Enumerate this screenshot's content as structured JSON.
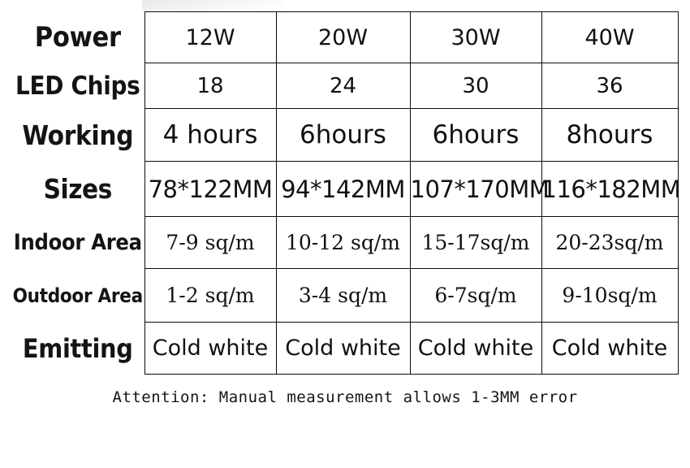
{
  "table": {
    "columns": [
      "12W",
      "20W",
      "30W",
      "40W"
    ],
    "rows": [
      {
        "key": "power",
        "label": "Power",
        "style": "sans",
        "values": [
          "12W",
          "20W",
          "30W",
          "40W"
        ]
      },
      {
        "key": "led_chips",
        "label": "LED Chips",
        "style": "sans",
        "values": [
          "18",
          "24",
          "30",
          "36"
        ]
      },
      {
        "key": "working",
        "label": "Working",
        "style": "sans",
        "values": [
          "4 hours",
          "6hours",
          "6hours",
          "8hours"
        ]
      },
      {
        "key": "sizes",
        "label": "Sizes",
        "style": "sans",
        "values": [
          "78*122MM",
          "94*142MM",
          "107*170MM",
          "116*182MM"
        ]
      },
      {
        "key": "indoor_area",
        "label": "Indoor Area",
        "style": "serif",
        "values": [
          "7-9  sq/m",
          "10-12  sq/m",
          "15-17sq/m",
          "20-23sq/m"
        ]
      },
      {
        "key": "outdoor_area",
        "label": "Outdoor Area",
        "style": "serif",
        "values": [
          "1-2  sq/m",
          "3-4  sq/m",
          "6-7sq/m",
          "9-10sq/m"
        ]
      },
      {
        "key": "emitting",
        "label": "Emitting",
        "style": "sans",
        "values": [
          "Cold white",
          "Cold white",
          "Cold white",
          "Cold white"
        ]
      }
    ]
  },
  "note": {
    "text": "Attention: Manual measurement allows 1-3MM error"
  },
  "colors": {
    "border": "#0d0d0d",
    "text": "#111111",
    "background": "#ffffff"
  }
}
